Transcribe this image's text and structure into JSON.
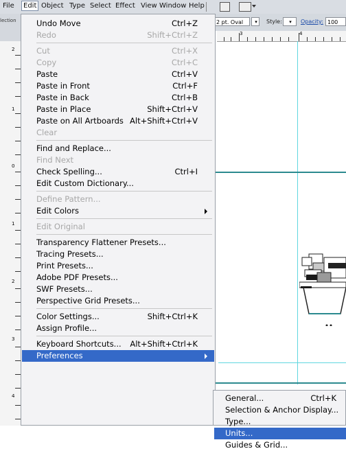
{
  "menubar": {
    "items": [
      "File",
      "Edit",
      "Object",
      "Type",
      "Select",
      "Effect",
      "View",
      "Window",
      "Help"
    ],
    "active": "Edit"
  },
  "left_label": "lection",
  "control_bar": {
    "stroke_profile": "2 pt. Oval",
    "style_label": "Style:",
    "opacity_label": "Opacity:",
    "opacity_value": "100"
  },
  "ruler": {
    "h_numbers": [
      "3",
      "4"
    ],
    "v_numbers": [
      "2",
      "1",
      "0",
      "1",
      "2",
      "3",
      "4"
    ]
  },
  "edit_menu": {
    "items": [
      {
        "label": "Undo Move",
        "shortcut": "Ctrl+Z",
        "enabled": true
      },
      {
        "label": "Redo",
        "shortcut": "Shift+Ctrl+Z",
        "enabled": false
      },
      {
        "sep": true
      },
      {
        "label": "Cut",
        "shortcut": "Ctrl+X",
        "enabled": false
      },
      {
        "label": "Copy",
        "shortcut": "Ctrl+C",
        "enabled": false
      },
      {
        "label": "Paste",
        "shortcut": "Ctrl+V",
        "enabled": true
      },
      {
        "label": "Paste in Front",
        "shortcut": "Ctrl+F",
        "enabled": true
      },
      {
        "label": "Paste in Back",
        "shortcut": "Ctrl+B",
        "enabled": true
      },
      {
        "label": "Paste in Place",
        "shortcut": "Shift+Ctrl+V",
        "enabled": true
      },
      {
        "label": "Paste on All Artboards",
        "shortcut": "Alt+Shift+Ctrl+V",
        "enabled": true
      },
      {
        "label": "Clear",
        "shortcut": "",
        "enabled": false
      },
      {
        "sep": true
      },
      {
        "label": "Find and Replace...",
        "shortcut": "",
        "enabled": true
      },
      {
        "label": "Find Next",
        "shortcut": "",
        "enabled": false
      },
      {
        "label": "Check Spelling...",
        "shortcut": "Ctrl+I",
        "enabled": true
      },
      {
        "label": "Edit Custom Dictionary...",
        "shortcut": "",
        "enabled": true
      },
      {
        "sep": true
      },
      {
        "label": "Define Pattern...",
        "shortcut": "",
        "enabled": false
      },
      {
        "label": "Edit Colors",
        "shortcut": "",
        "enabled": true,
        "submenu": true
      },
      {
        "sep": true
      },
      {
        "label": "Edit Original",
        "shortcut": "",
        "enabled": false
      },
      {
        "sep": true
      },
      {
        "label": "Transparency Flattener Presets...",
        "shortcut": "",
        "enabled": true
      },
      {
        "label": "Tracing Presets...",
        "shortcut": "",
        "enabled": true
      },
      {
        "label": "Print Presets...",
        "shortcut": "",
        "enabled": true
      },
      {
        "label": "Adobe PDF Presets...",
        "shortcut": "",
        "enabled": true
      },
      {
        "label": "SWF Presets...",
        "shortcut": "",
        "enabled": true
      },
      {
        "label": "Perspective Grid Presets...",
        "shortcut": "",
        "enabled": true
      },
      {
        "sep": true
      },
      {
        "label": "Color Settings...",
        "shortcut": "Shift+Ctrl+K",
        "enabled": true
      },
      {
        "label": "Assign Profile...",
        "shortcut": "",
        "enabled": true
      },
      {
        "sep": true
      },
      {
        "label": "Keyboard Shortcuts...",
        "shortcut": "Alt+Shift+Ctrl+K",
        "enabled": true
      },
      {
        "label": "Preferences",
        "shortcut": "",
        "enabled": true,
        "submenu": true,
        "selected": true
      }
    ]
  },
  "preferences_submenu": {
    "items": [
      {
        "label": "General...",
        "shortcut": "Ctrl+K"
      },
      {
        "label": "Selection & Anchor Display...",
        "shortcut": ""
      },
      {
        "label": "Type...",
        "shortcut": ""
      },
      {
        "label": "Units...",
        "shortcut": "",
        "selected": true
      },
      {
        "label": "Guides & Grid...",
        "shortcut": ""
      }
    ]
  },
  "colors": {
    "highlight": "#3469c8",
    "guide_teal": "#2b8a8f",
    "guide_cyan": "#5fd6e0"
  }
}
